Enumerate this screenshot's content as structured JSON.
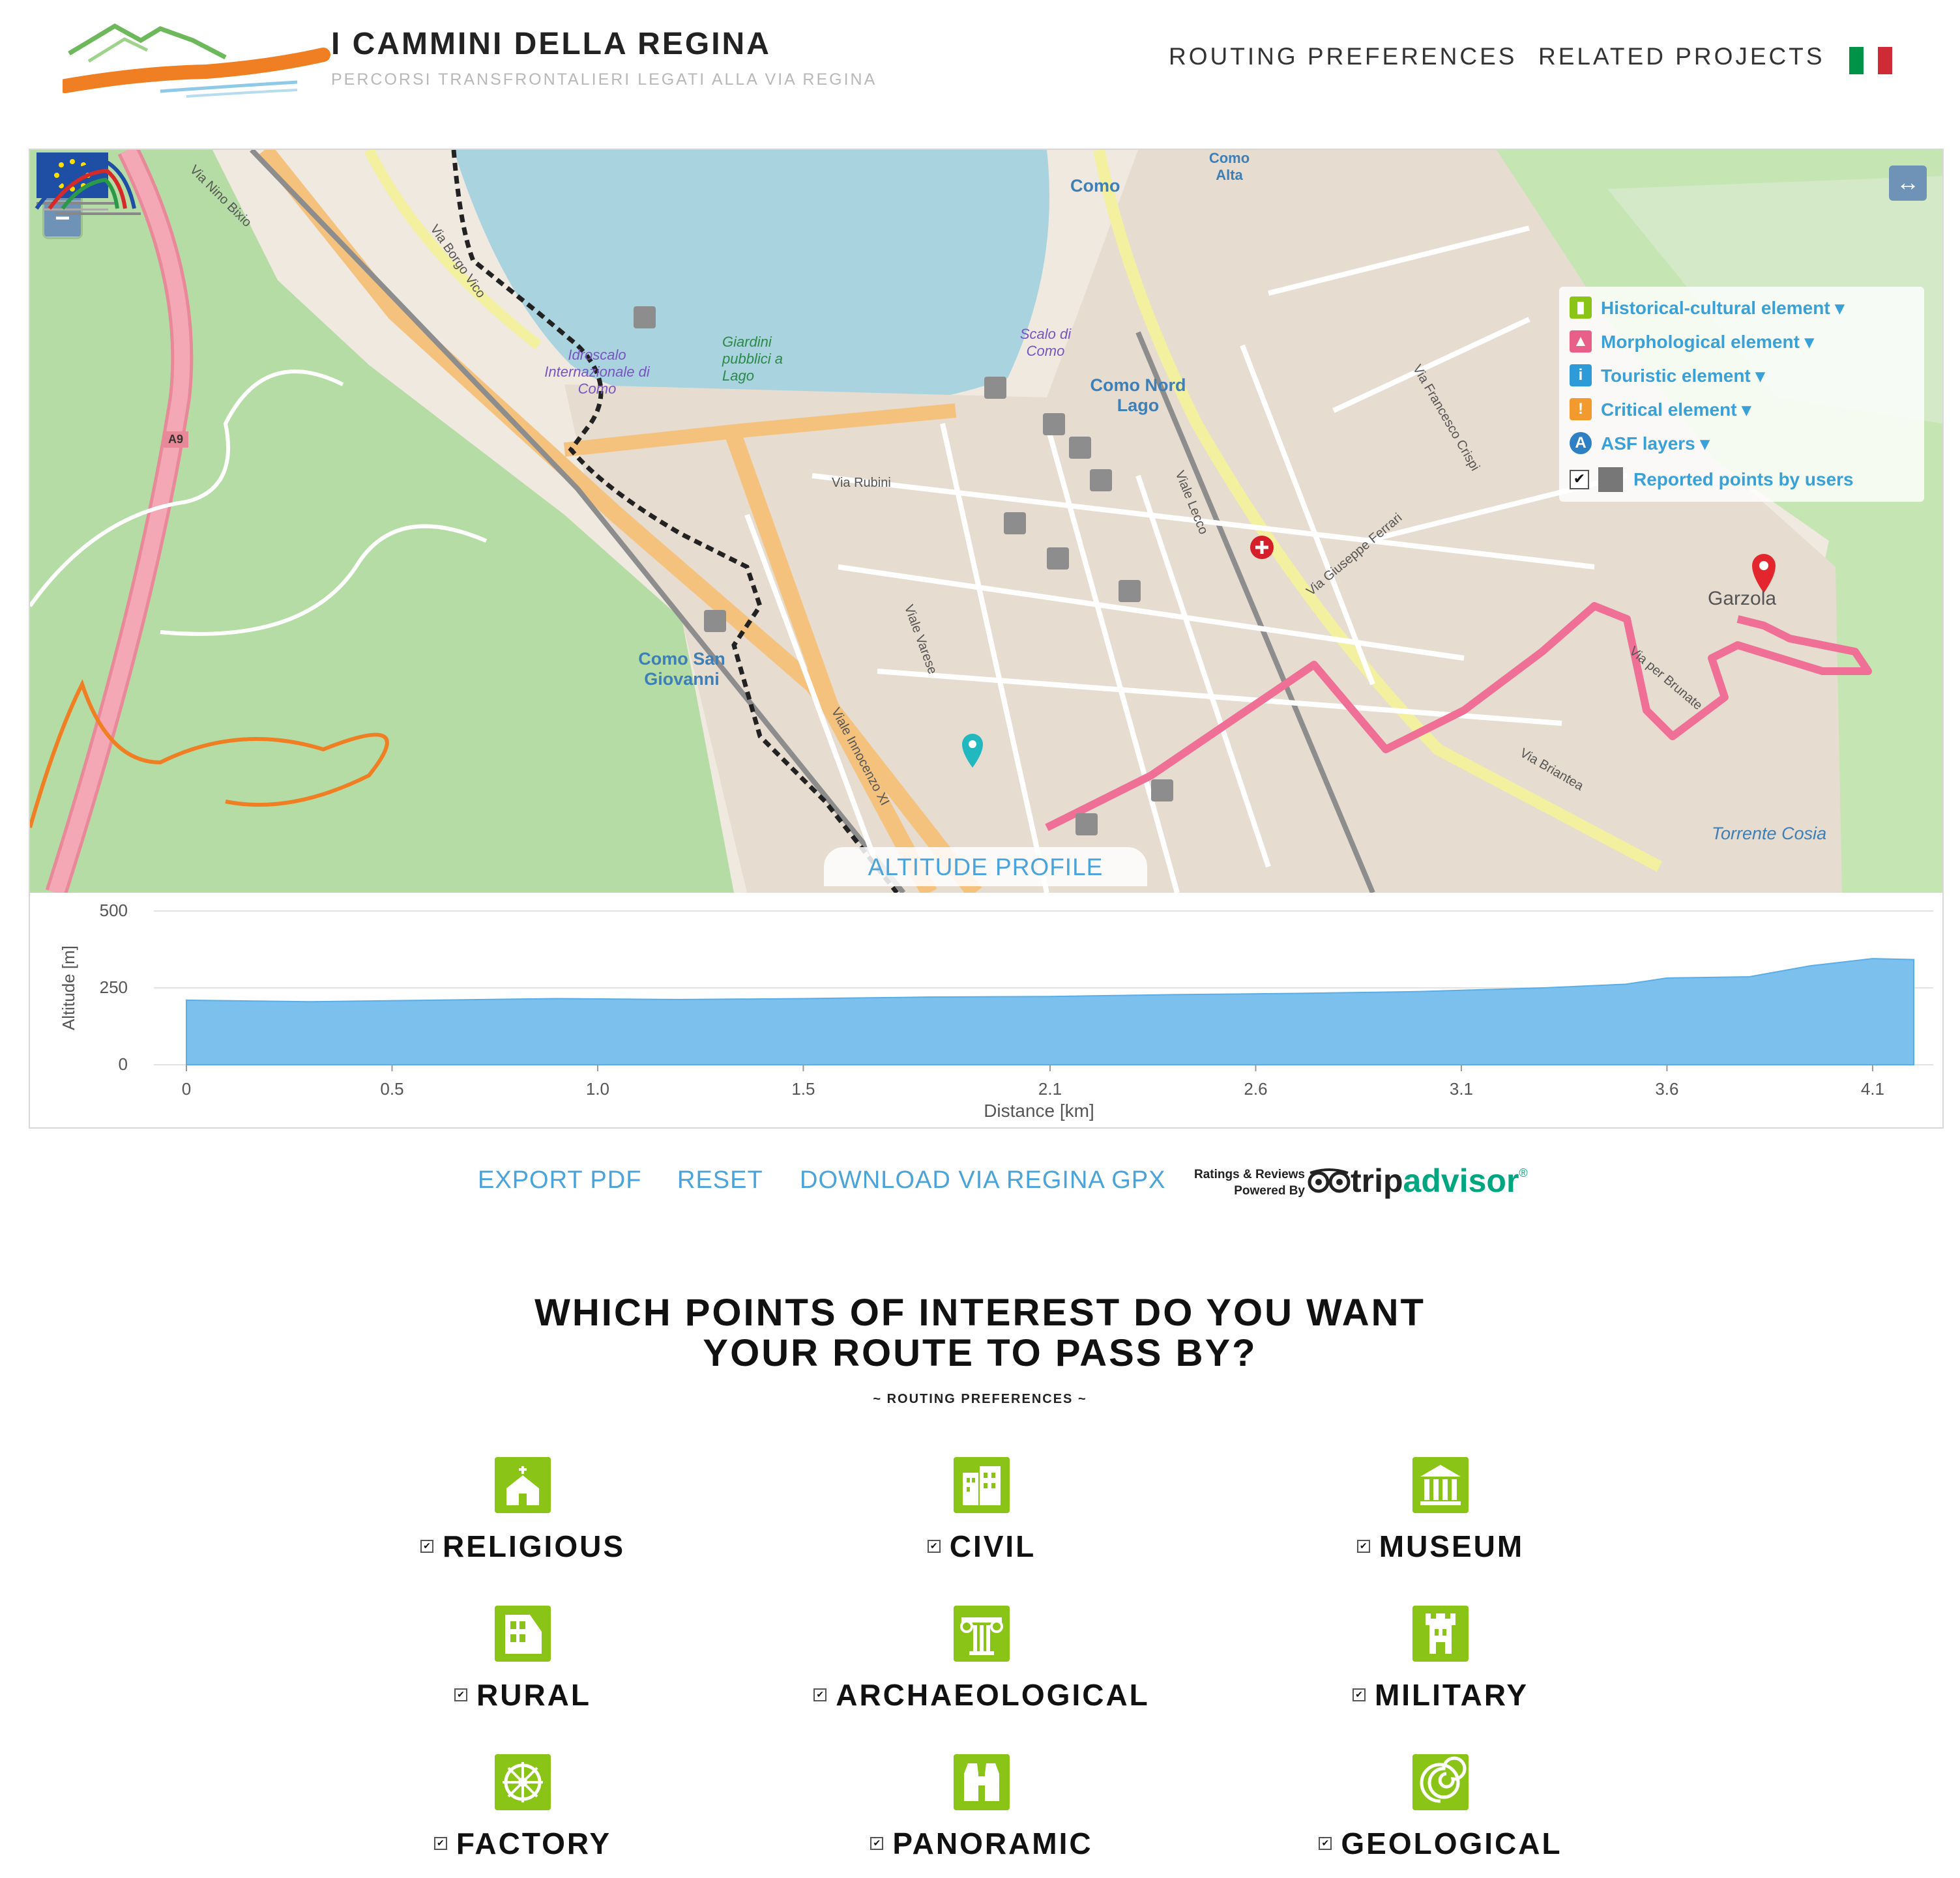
{
  "header": {
    "title": "I CAMMINI DELLA REGINA",
    "subtitle": "PERCORSI TRANSFRONTALIERI LEGATI ALLA VIA REGINA",
    "nav": [
      "ROUTING PREFERENCES",
      "RELATED PROJECTS"
    ],
    "flag_colors": [
      "#009246",
      "#ffffff",
      "#ce2b37"
    ]
  },
  "map": {
    "zoom_in": "+",
    "zoom_out": "−",
    "expand": "↔",
    "layers": [
      {
        "label": "Historical-cultural element ▾",
        "color": "#8ac417",
        "icon": "tower-icon"
      },
      {
        "label": "Morphological element ▾",
        "color": "#e8608a",
        "icon": "mountain-icon"
      },
      {
        "label": "Touristic element ▾",
        "color": "#2f9ad8",
        "icon": "info-icon"
      },
      {
        "label": "Critical element ▾",
        "color": "#f29a2e",
        "icon": "warning-icon"
      },
      {
        "label": "ASF layers ▾",
        "color": "#2f7fc4",
        "icon": "asf-icon"
      },
      {
        "label": "Reported points by users",
        "checked": "✔",
        "color": "#777777"
      }
    ],
    "labels": [
      "Como",
      "Como Nord Lago",
      "Como San Giovanni",
      "Garzola",
      "Giardini pubblici a Lago",
      "Idroscalo Internazionale di Como",
      "Scalo di Como",
      "Como Alta",
      "Torrente Cosia",
      "A9",
      "Via Nino Bixio",
      "Via Borgo Vico",
      "Viale Innocenzo XI",
      "Viale Varese",
      "Viale Lecco",
      "Via Briantea",
      "Via per Brunate",
      "Via Rubini",
      "Via Giuseppe Ferrari",
      "Via Francesco Crispi"
    ],
    "altitude_tab": "ALTITUDE PROFILE"
  },
  "chart_data": {
    "type": "area",
    "xlabel": "Distance [km]",
    "ylabel": "Altitude [m]",
    "x_ticks": [
      "0",
      "0.5",
      "1.0",
      "1.5",
      "2.1",
      "2.6",
      "3.1",
      "3.6",
      "4.1"
    ],
    "y_ticks": [
      "0",
      "250",
      "500"
    ],
    "ylim": [
      0,
      500
    ],
    "xlim": [
      0,
      4.2
    ],
    "x": [
      0,
      0.3,
      0.6,
      0.9,
      1.2,
      1.5,
      1.8,
      2.1,
      2.4,
      2.7,
      3.0,
      3.3,
      3.5,
      3.6,
      3.8,
      3.95,
      4.1,
      4.2
    ],
    "y": [
      210,
      205,
      210,
      215,
      212,
      215,
      220,
      222,
      228,
      232,
      238,
      250,
      262,
      282,
      286,
      322,
      345,
      342
    ],
    "fill_color": "#7cc0ee"
  },
  "actions": {
    "export_pdf": "EXPORT PDF",
    "reset": "RESET",
    "download_gpx": "DOWNLOAD VIA REGINA GPX",
    "tripadvisor_small_1": "Ratings & Reviews",
    "tripadvisor_small_2": "Powered By",
    "tripadvisor_word1": "trip",
    "tripadvisor_word2": "advisor",
    "tripadvisor_mark": "®"
  },
  "preferences": {
    "title_line1": "WHICH POINTS OF INTEREST DO YOU WANT",
    "title_line2": "YOUR ROUTE TO PASS BY?",
    "subtitle": "~ ROUTING PREFERENCES ~",
    "check_mark": "✔",
    "icon_color": "#8ac417",
    "items": [
      {
        "label": "RELIGIOUS",
        "icon": "church-icon"
      },
      {
        "label": "CIVIL",
        "icon": "buildings-icon"
      },
      {
        "label": "MUSEUM",
        "icon": "museum-icon"
      },
      {
        "label": "RURAL",
        "icon": "farmhouse-icon"
      },
      {
        "label": "ARCHAEOLOGICAL",
        "icon": "column-icon"
      },
      {
        "label": "MILITARY",
        "icon": "castle-tower-icon"
      },
      {
        "label": "FACTORY",
        "icon": "wheel-icon"
      },
      {
        "label": "PANORAMIC",
        "icon": "binoculars-icon"
      },
      {
        "label": "GEOLOGICAL",
        "icon": "ammonite-icon"
      }
    ]
  }
}
